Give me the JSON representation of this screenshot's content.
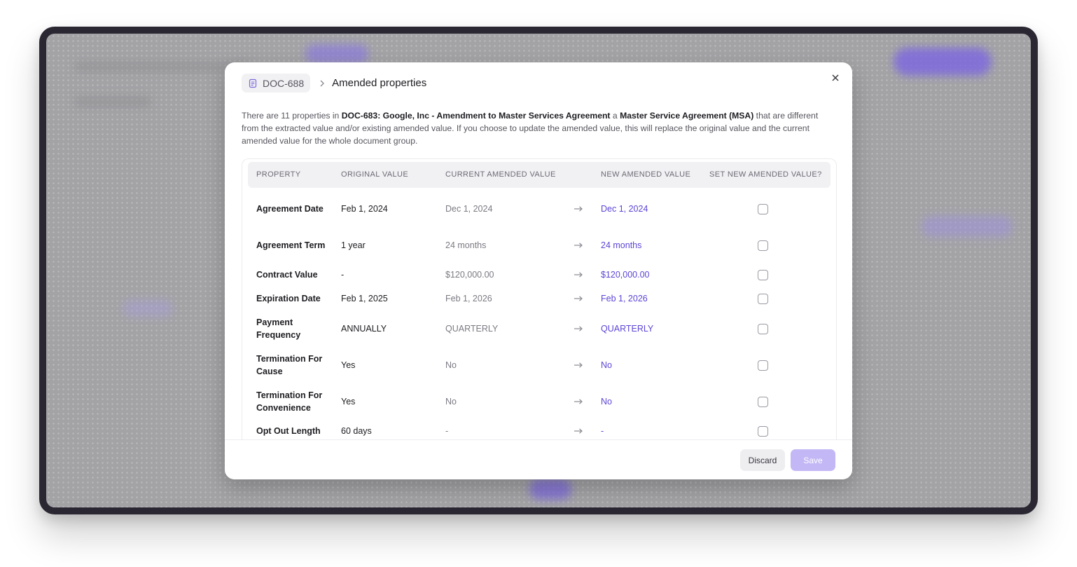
{
  "modal": {
    "breadcrumb": {
      "doc_id": "DOC-688",
      "icon": "document-icon",
      "separator_icon": "chevron-right-icon",
      "title": "Amended properties"
    },
    "close_icon": "close-icon",
    "description": {
      "prefix": "There are 11 properties in ",
      "document_name": "DOC-683: Google, Inc - Amendment to Master Services Agreement",
      "connector": " a ",
      "document_type": "Master Service Agreement (MSA)",
      "suffix": " that are different from the extracted value and/or existing amended value. If you choose to update the amended value, this will replace the original value and the current amended value for the whole document group."
    },
    "table": {
      "headers": {
        "property": "PROPERTY",
        "original": "ORIGINAL VALUE",
        "current": "CURRENT AMENDED VALUE",
        "new": "NEW AMENDED VALUE",
        "set": "SET NEW AMENDED VALUE?"
      },
      "arrow": "→",
      "rows": [
        {
          "property": "Agreement Date",
          "original": "Feb 1, 2024",
          "current": "Dec 1, 2024",
          "new": "Dec 1, 2024",
          "checked": false
        },
        {
          "property": "Agreement Term",
          "original": "1 year",
          "current": "24 months",
          "new": "24 months",
          "checked": false
        },
        {
          "property": "Contract Value",
          "original": "-",
          "current": "$120,000.00",
          "new": "$120,000.00",
          "checked": false
        },
        {
          "property": "Expiration Date",
          "original": "Feb 1, 2025",
          "current": "Feb 1, 2026",
          "new": "Feb 1, 2026",
          "checked": false
        },
        {
          "property": "Payment Frequency",
          "original": "ANNUALLY",
          "current": "QUARTERLY",
          "new": "QUARTERLY",
          "checked": false
        },
        {
          "property": "Termination For Cause",
          "original": "Yes",
          "current": "No",
          "new": "No",
          "checked": false
        },
        {
          "property": "Termination For Convenience",
          "original": "Yes",
          "current": "No",
          "new": "No",
          "checked": false
        },
        {
          "property": "Opt Out Length",
          "original": "60 days",
          "current": "-",
          "new": "-",
          "checked": false
        }
      ]
    },
    "footer": {
      "discard_label": "Discard",
      "save_label": "Save"
    }
  },
  "colors": {
    "accent": "#5b45d6",
    "save_disabled": "#c3b8f5",
    "overlay": "#a3a3a6"
  }
}
